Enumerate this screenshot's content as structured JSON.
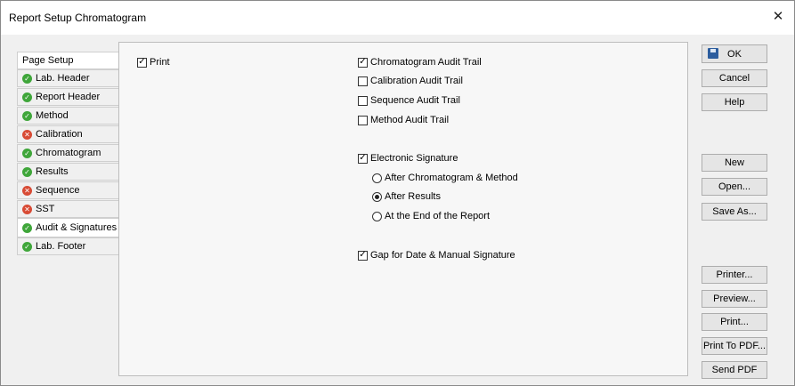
{
  "window": {
    "title": "Report Setup Chromatogram"
  },
  "tabs": [
    {
      "label": "Page Setup",
      "status": ""
    },
    {
      "label": "Lab. Header",
      "status": "ok"
    },
    {
      "label": "Report Header",
      "status": "ok"
    },
    {
      "label": "Method",
      "status": "ok"
    },
    {
      "label": "Calibration",
      "status": "error"
    },
    {
      "label": "Chromatogram",
      "status": "ok"
    },
    {
      "label": "Results",
      "status": "ok"
    },
    {
      "label": "Sequence",
      "status": "error"
    },
    {
      "label": "SST",
      "status": "error"
    },
    {
      "label": "Audit & Signatures",
      "status": "ok"
    },
    {
      "label": "Lab. Footer",
      "status": "ok"
    }
  ],
  "active_tab": "Audit & Signatures",
  "options": {
    "print": {
      "label": "Print",
      "checked": true
    },
    "chromatogram_audit_trail": {
      "label": "Chromatogram Audit Trail",
      "checked": true
    },
    "calibration_audit_trail": {
      "label": "Calibration Audit Trail",
      "checked": false
    },
    "sequence_audit_trail": {
      "label": "Sequence Audit Trail",
      "checked": false
    },
    "method_audit_trail": {
      "label": "Method Audit Trail",
      "checked": false
    },
    "electronic_signature": {
      "label": "Electronic Signature",
      "checked": true
    },
    "signature_position": {
      "choices": [
        "After Chromatogram & Method",
        "After Results",
        "At the End of the Report"
      ],
      "selected": "After Results"
    },
    "gap_for_date": {
      "label": "Gap for Date & Manual Signature",
      "checked": true
    }
  },
  "buttons": {
    "ok": "OK",
    "cancel": "Cancel",
    "help": "Help",
    "new": "New",
    "open": "Open...",
    "save_as": "Save As...",
    "printer": "Printer...",
    "preview": "Preview...",
    "print": "Print...",
    "print_to_pdf": "Print To PDF...",
    "send_pdf": "Send PDF"
  },
  "icons": {
    "close": "close-icon",
    "save": "save-icon",
    "ok_status": "check-circle-icon",
    "error_status": "x-circle-icon"
  },
  "colors": {
    "ok": "#3fa63a",
    "error": "#d84b35",
    "save_icon": "#2c5d9e"
  }
}
